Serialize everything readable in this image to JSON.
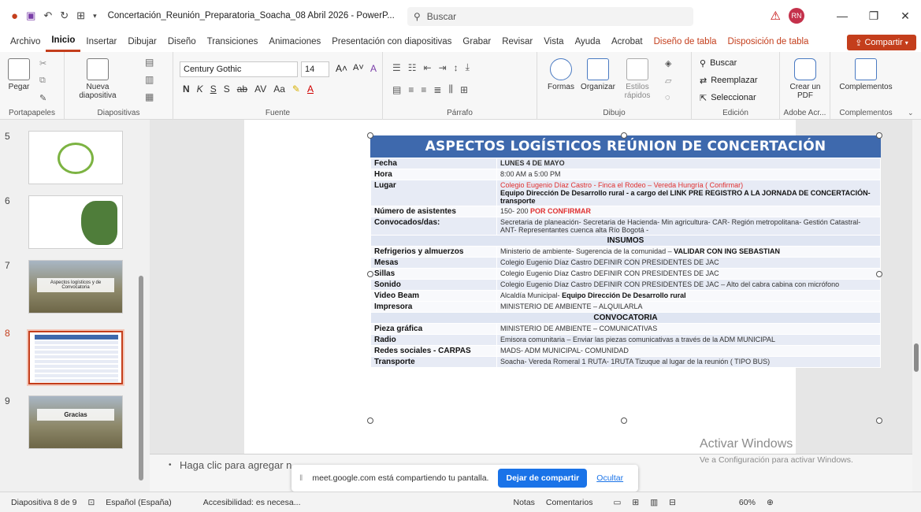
{
  "window": {
    "title": "Concertación_Reunión_Preparatoria_Soacha_08 Abril 2026 - PowerP...",
    "search_placeholder": "Buscar",
    "user_initials": "RN"
  },
  "tabs": [
    "Archivo",
    "Inicio",
    "Insertar",
    "Dibujar",
    "Diseño",
    "Transiciones",
    "Animaciones",
    "Presentación con diapositivas",
    "Grabar",
    "Revisar",
    "Vista",
    "Ayuda",
    "Acrobat",
    "Diseño de tabla",
    "Disposición de tabla"
  ],
  "share_label": "Compartir",
  "ribbon": {
    "paste": "Pegar",
    "new_slide": "Nueva diapositiva",
    "font_name": "Century Gothic",
    "font_size": "14",
    "search": "Buscar",
    "replace": "Reemplazar",
    "select": "Seleccionar",
    "shapes": "Formas",
    "arrange": "Organizar",
    "quick_styles": "Estilos rápidos",
    "create_pdf": "Crear un PDF",
    "addins": "Complementos",
    "groups": {
      "clipboard": "Portapapeles",
      "slides": "Diapositivas",
      "font": "Fuente",
      "paragraph": "Párrafo",
      "drawing": "Dibujo",
      "editing": "Edición",
      "adobe": "Adobe Acr...",
      "addins": "Complementos"
    }
  },
  "thumbnails": [
    {
      "num": "5"
    },
    {
      "num": "6"
    },
    {
      "num": "7",
      "caption": "Aspectos logísticos y de Convocatoria"
    },
    {
      "num": "8"
    },
    {
      "num": "9",
      "caption": "Gracias"
    }
  ],
  "slide": {
    "title": "ASPECTOS LOGÍSTICOS REÚNION DE CONCERTACIÓN",
    "rows": {
      "fecha_k": "Fecha",
      "fecha_v": "LUNES 4 DE MAYO",
      "hora_k": "Hora",
      "hora_v": "8:00 AM a 5:00 PM",
      "lugar_k": "Lugar",
      "lugar_v1": "Colegio Eugenio Díaz Castro - Finca el Rodeo – Vereda Hungría  ( Confirmar)",
      "lugar_v2": "Equipo Dirección De Desarrollo rural - a cargo del LINK PRE REGISTRO A LA JORNADA DE CONCERTACIÓN- transporte",
      "asist_k": "Número de asistentes",
      "asist_v1": "150- 200",
      "asist_v2": "POR CONFIRMAR",
      "conv_k": "Convocados/das:",
      "conv_v": "Secretaria de planeación- Secretaria de Hacienda- Min agricultura- CAR- Región metropolitana- Gestión Catastral- ANT- Representantes cuenca alta Río Bogotá -",
      "insumos": "INSUMOS",
      "refr_k": "Refrigerios y almuerzos",
      "refr_v1": "Ministerio de ambiente-  Sugerencia de la comunidad –",
      "refr_v2": "VALIDAR CON ING SEBASTIAN",
      "mesas_k": "Mesas",
      "mesas_v": "Colegio Eugenio Díaz Castro  DEFINIR CON PRESIDENTES DE JAC",
      "sillas_k": "Sillas",
      "sillas_v": "Colegio Eugenio Díaz Castro  DEFINIR CON PRESIDENTES DE JAC",
      "sonido_k": "Sonido",
      "sonido_v": "Colegio Eugenio Díaz Castro  DEFINIR CON PRESIDENTES DE JAC – Alto del cabra cabina con micrófono",
      "video_k": "Video Beam",
      "video_v1": "Alcaldía Municipal-",
      "video_v2": "Equipo Dirección De Desarrollo rural",
      "impr_k": "Impresora",
      "impr_v": "MINISTERIO DE AMBIENTE – ALQUILARLA",
      "convocatoria": "CONVOCATORIA",
      "pieza_k": "Pieza gráfica",
      "pieza_v": "MINISTERIO DE AMBIENTE – COMUNICATIVAS",
      "radio_k": "Radio",
      "radio_v": "Emisora comunitaria – Enviar las piezas comunicativas a través de la ADM MUNICIPAL",
      "redes_k": "Redes sociales - CARPAS",
      "redes_v": "MADS- ADM MUNICIPAL- COMUNIDAD",
      "transp_k": "Transporte",
      "transp_v": "Soacha- Vereda Romeral 1 RUTA-  1RUTA Tizuque al lugar de la reunión ( TIPO BUS)"
    }
  },
  "notes_placeholder": "Haga clic para agregar n",
  "share_banner": {
    "message": "meet.google.com está compartiendo tu pantalla.",
    "stop": "Dejar de compartir",
    "hide": "Ocultar"
  },
  "activate": {
    "line1": "Activar Windows",
    "line2": "Ve a Configuración para activar Windows."
  },
  "status": {
    "slide_info": "Diapositiva 8 de 9",
    "language": "Español (España)",
    "accessibility": "Accesibilidad: es necesa...",
    "notes": "Notas",
    "comments": "Comentarios",
    "zoom": "60%"
  }
}
